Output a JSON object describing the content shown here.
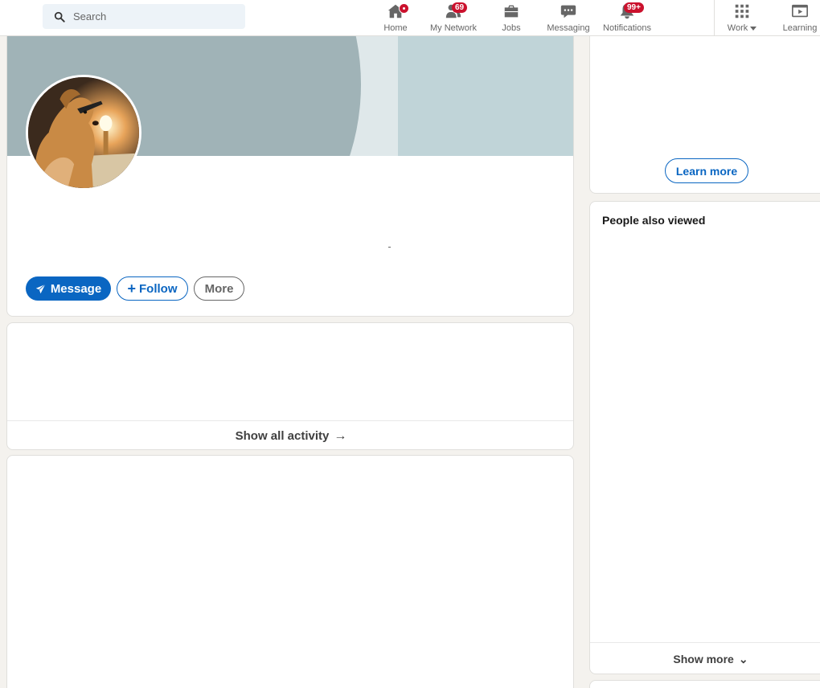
{
  "nav": {
    "search_placeholder": "Search",
    "items": [
      {
        "label": "Home",
        "icon": "home-icon"
      },
      {
        "label": "My Network",
        "icon": "people-icon",
        "badge": "69"
      },
      {
        "label": "Jobs",
        "icon": "briefcase-icon"
      },
      {
        "label": "Messaging",
        "icon": "chat-icon"
      },
      {
        "label": "Notifications",
        "icon": "bell-icon",
        "badge": "99+"
      },
      {
        "label": "Work",
        "icon": "grid-icon"
      },
      {
        "label": "Learning",
        "icon": "play-icon"
      }
    ]
  },
  "profile": {
    "message_label": "Message",
    "follow_label": "Follow",
    "more_label": "More"
  },
  "activity": {
    "footer_label": "Show all activity",
    "footer_arrow": "→"
  },
  "sidebar": {
    "learn_more_label": "Learn more",
    "people_title": "People also viewed",
    "show_more_label": "Show more",
    "show_more_chevron": "⌄"
  },
  "colors": {
    "accent": "#0a66c2",
    "badge": "#cb112d",
    "background": "#f4f2ee"
  }
}
